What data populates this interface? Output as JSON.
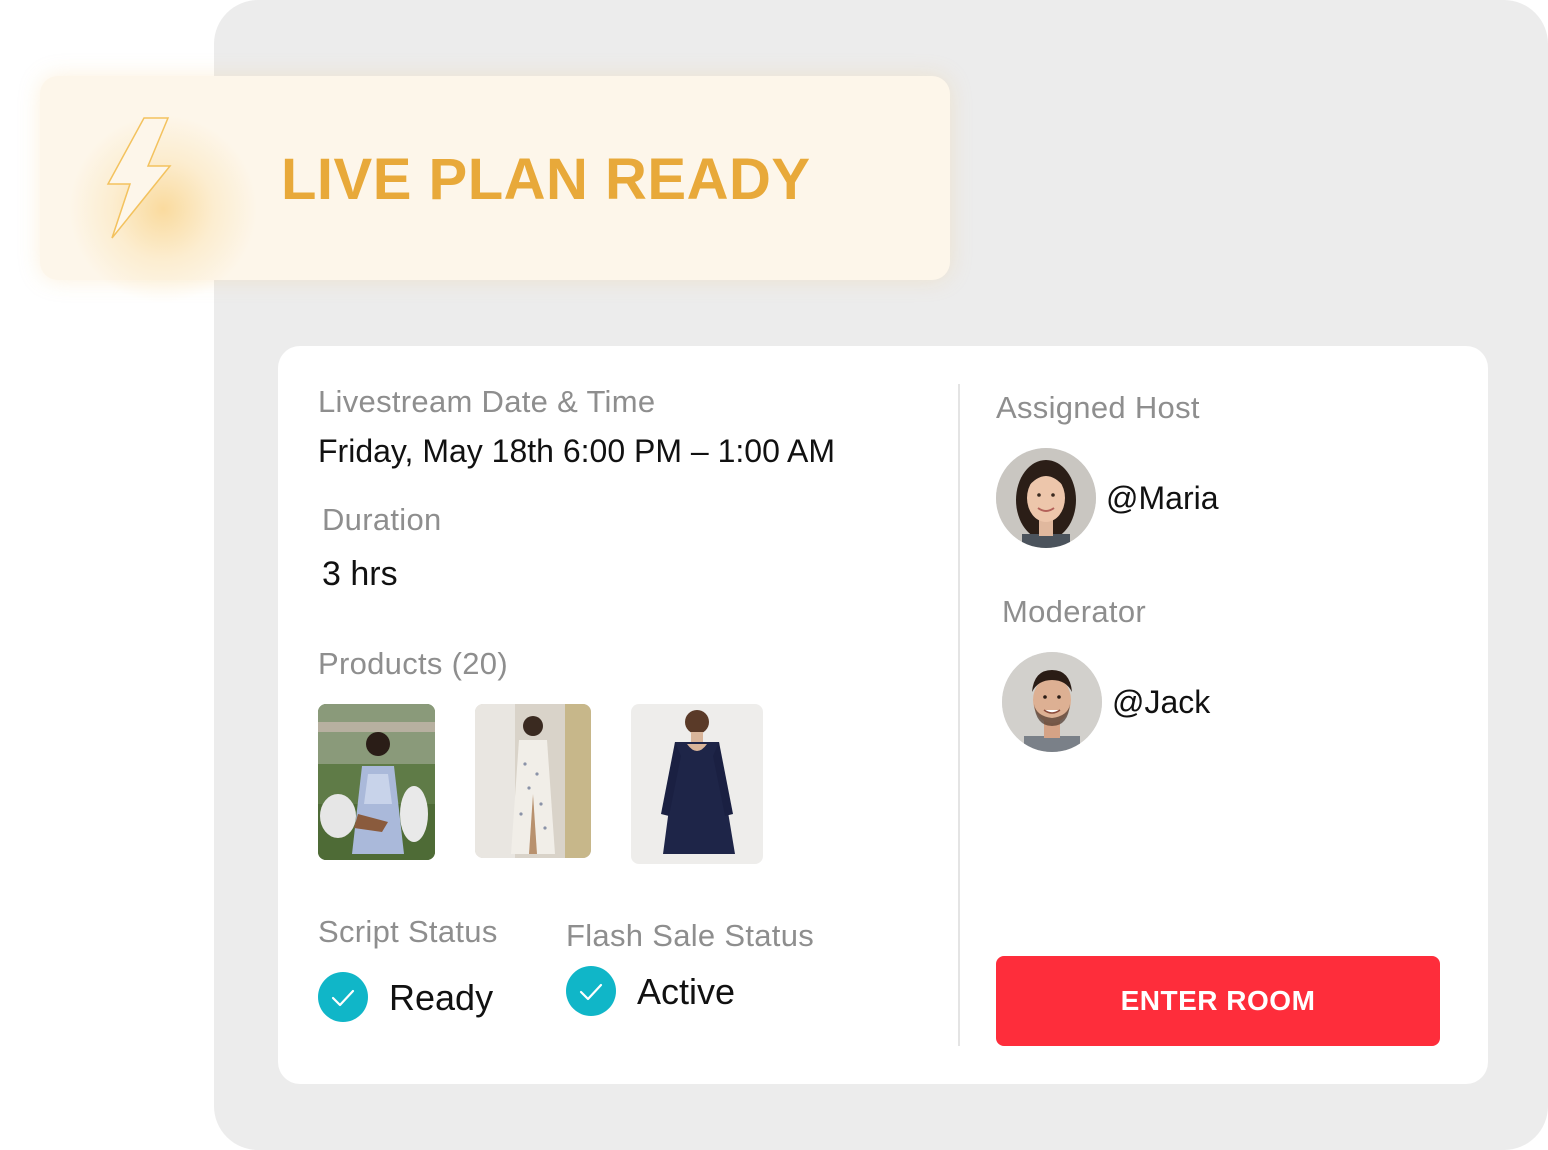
{
  "banner": {
    "title": "LIVE PLAN READY",
    "icon": "lightning-bolt-icon",
    "accent_color": "#e8a93a"
  },
  "schedule": {
    "label": "Livestream Date & Time",
    "value": "Friday, May 18th 6:00 PM – 1:00 AM"
  },
  "duration": {
    "label": "Duration",
    "value": "3 hrs"
  },
  "products": {
    "label": "Products (20)",
    "items": [
      {
        "name": "floral-blue-dress-photo"
      },
      {
        "name": "white-floral-slip-dress-photo"
      },
      {
        "name": "navy-velvet-dress-photo"
      }
    ]
  },
  "script_status": {
    "label": "Script Status",
    "value": "Ready",
    "icon": "check-circle-icon"
  },
  "flash_sale_status": {
    "label": "Flash Sale Status",
    "value": "Active",
    "icon": "check-circle-icon"
  },
  "host": {
    "label": "Assigned Host",
    "handle": "@Maria"
  },
  "moderator": {
    "label": "Moderator",
    "handle": "@Jack"
  },
  "actions": {
    "enter_room": "ENTER ROOM",
    "button_color": "#fe2d3b"
  },
  "colors": {
    "status_check": "#10b6c8",
    "label_gray": "#8e8e8e"
  }
}
